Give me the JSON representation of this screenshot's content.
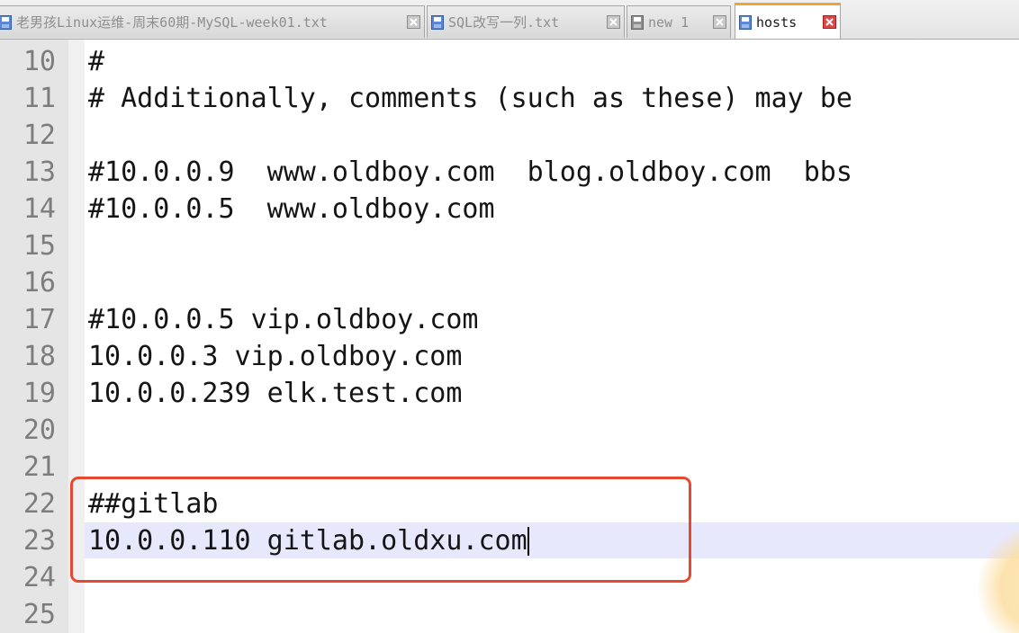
{
  "tabs": [
    {
      "label": "老男孩Linux运维-周末60期-MySQL-week01.txt",
      "active": false,
      "modified": true
    },
    {
      "label": "SQL改写一列.txt",
      "active": false,
      "modified": true
    },
    {
      "label": "new 1",
      "active": false,
      "modified": false
    },
    {
      "label": "hosts",
      "active": true,
      "modified": true
    }
  ],
  "editor": {
    "lines": [
      {
        "no": "10",
        "text": "#"
      },
      {
        "no": "11",
        "text": "# Additionally, comments (such as these) may be"
      },
      {
        "no": "12",
        "text": ""
      },
      {
        "no": "13",
        "text": "#10.0.0.9  www.oldboy.com  blog.oldboy.com  bbs"
      },
      {
        "no": "14",
        "text": "#10.0.0.5  www.oldboy.com"
      },
      {
        "no": "15",
        "text": ""
      },
      {
        "no": "16",
        "text": ""
      },
      {
        "no": "17",
        "text": "#10.0.0.5 vip.oldboy.com"
      },
      {
        "no": "18",
        "text": "10.0.0.3 vip.oldboy.com"
      },
      {
        "no": "19",
        "text": "10.0.0.239 elk.test.com"
      },
      {
        "no": "20",
        "text": ""
      },
      {
        "no": "21",
        "text": ""
      },
      {
        "no": "22",
        "text": "##gitlab"
      },
      {
        "no": "23",
        "text": "10.0.0.110 gitlab.oldxu.com"
      },
      {
        "no": "24",
        "text": ""
      },
      {
        "no": "25",
        "text": ""
      }
    ]
  },
  "colors": {
    "accent_tab": "#f0a431",
    "annotation_box": "#e8482f",
    "current_line": "#e8e8fc",
    "gutter": "#e5e5e5"
  }
}
